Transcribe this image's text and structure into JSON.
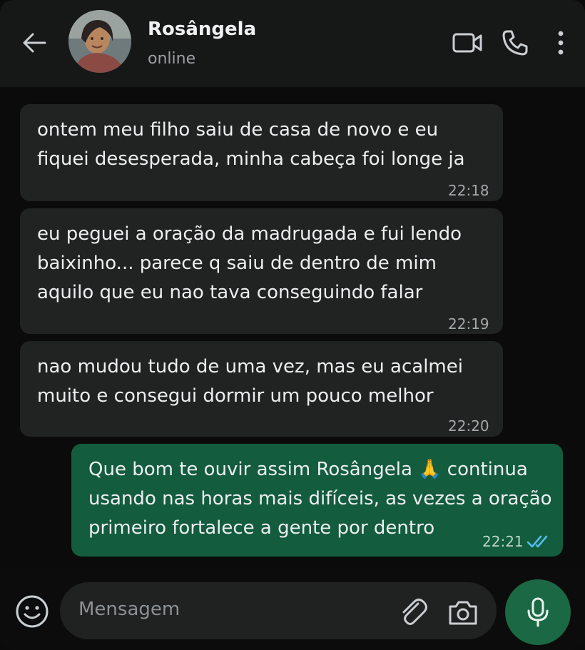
{
  "header": {
    "contact_name": "Rosângela",
    "status": "online"
  },
  "messages": [
    {
      "direction": "incoming",
      "lines": [
        "ontem meu filho saiu de casa de novo e eu",
        "fiquei desesperada, minha cabeça foi longe ja"
      ],
      "time": "22:18"
    },
    {
      "direction": "incoming",
      "lines": [
        "eu peguei a oração da madrugada e fui lendo",
        "baixinho... parece q saiu de dentro de mim",
        "aquilo que eu nao tava conseguindo falar"
      ],
      "time": "22:19"
    },
    {
      "direction": "incoming",
      "lines": [
        "nao mudou tudo de uma vez, mas eu acalmei",
        "muito e consegui dormir um pouco melhor"
      ],
      "time": "22:20"
    },
    {
      "direction": "outgoing",
      "lines": [
        "Que bom te ouvir assim Rosângela 🙏 continua",
        "usando nas horas mais difíceis, as vezes a oração",
        "primeiro fortalece a gente por dentro"
      ],
      "time": "22:21",
      "status": "read"
    }
  ],
  "composer": {
    "placeholder": "Mensagem"
  },
  "icons": {
    "back": "arrow-left-icon",
    "video": "video-camera-icon",
    "call": "phone-icon",
    "menu": "more-vertical-icon",
    "emoji": "emoji-icon",
    "attach": "paperclip-icon",
    "camera": "camera-icon",
    "mic": "microphone-icon",
    "read": "double-check-icon"
  },
  "colors": {
    "incoming_bubble": "#212222",
    "outgoing_bubble": "#135c3e",
    "read_receipt": "#53bdeb",
    "mic_button": "#1b6845"
  }
}
